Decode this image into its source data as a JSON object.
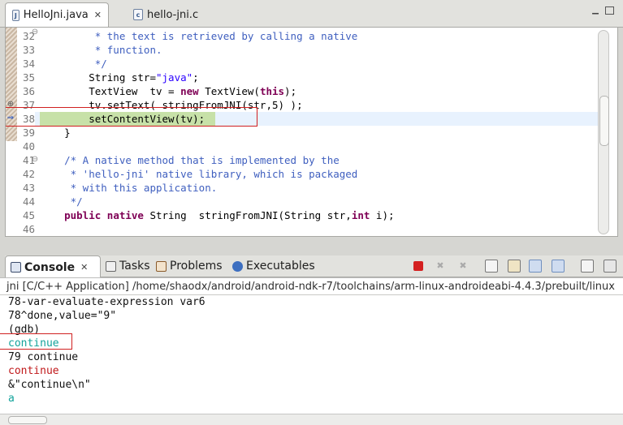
{
  "editor": {
    "tabs": [
      {
        "label": "HelloJni.java",
        "icon": "java-file-icon",
        "active": true
      },
      {
        "label": "hello-jni.c",
        "icon": "c-file-icon",
        "active": false
      }
    ],
    "close_glyph": "✕",
    "lines": [
      {
        "num": "32",
        "code": "         * the text is retrieved by calling a native"
      },
      {
        "num": "33",
        "code": "         * function."
      },
      {
        "num": "34",
        "code": "         */"
      },
      {
        "num": "35",
        "code_parts": [
          "        String str=",
          "\"java\"",
          ";"
        ]
      },
      {
        "num": "36",
        "code_parts": [
          "        TextView  tv = ",
          "new",
          " TextView(",
          "this",
          ");"
        ]
      },
      {
        "num": "37",
        "code": "        tv.setText( stringFromJNI(str,5) );"
      },
      {
        "num": "38",
        "code": "        setContentView(tv);"
      },
      {
        "num": "39",
        "code": "    }"
      },
      {
        "num": "40",
        "code": ""
      },
      {
        "num": "41",
        "code": "    /* A native method that is implemented by the"
      },
      {
        "num": "42",
        "code": "     * 'hello-jni' native library, which is packaged"
      },
      {
        "num": "43",
        "code": "     * with this application."
      },
      {
        "num": "44",
        "code": "     */"
      },
      {
        "num": "45",
        "code_parts": [
          "    ",
          "public",
          " ",
          "native",
          " String  stringFromJNI(String str,",
          "int",
          " i);"
        ]
      },
      {
        "num": "46",
        "code": ""
      }
    ]
  },
  "console_view": {
    "tabs": [
      {
        "label": "Console",
        "icon": "console-icon",
        "active": true
      },
      {
        "label": "Tasks",
        "icon": "tasks-icon",
        "active": false
      },
      {
        "label": "Problems",
        "icon": "problems-icon",
        "active": false
      },
      {
        "label": "Executables",
        "icon": "executables-icon",
        "active": false
      }
    ],
    "title": "jni [C/C++ Application] /home/shaodx/android/android-ndk-r7/toolchains/arm-linux-androideabi-4.4.3/prebuilt/linux",
    "lines": [
      {
        "text": "78-var-evaluate-expression var6",
        "color": "black"
      },
      {
        "text": "78^done,value=\"9\"",
        "color": "black"
      },
      {
        "text": "(gdb)",
        "color": "black"
      },
      {
        "text": "continue",
        "color": "teal"
      },
      {
        "text": "79 continue",
        "color": "black"
      },
      {
        "text": "continue",
        "color": "red"
      },
      {
        "text": "&\"continue\\n\"",
        "color": "black"
      },
      {
        "text": "a",
        "color": "teal"
      }
    ]
  },
  "colors": {
    "keyword": "#7f0055",
    "comment": "#3f5fbf",
    "string": "#2a00ff",
    "console_input": "#13a39b",
    "console_error": "#c0181a",
    "highlight_box": "#d02020"
  }
}
